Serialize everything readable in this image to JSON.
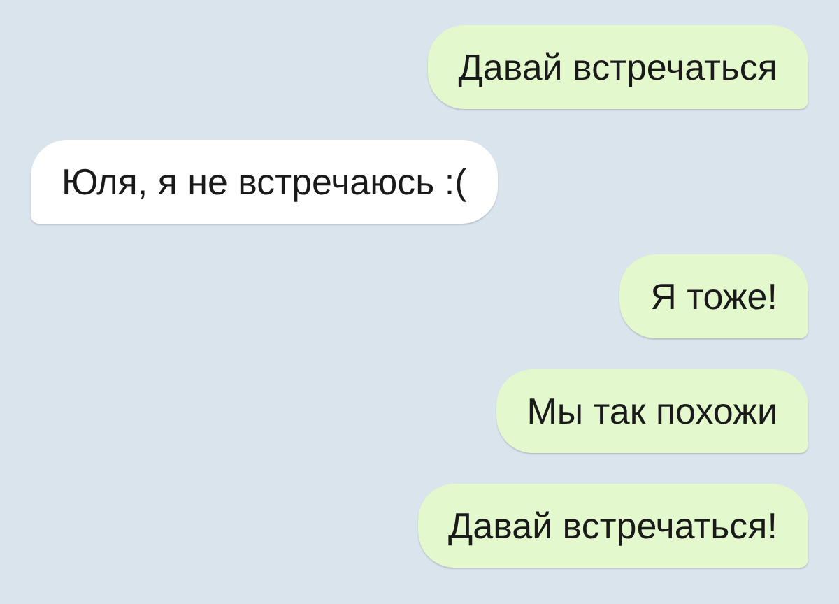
{
  "messages": [
    {
      "kind": "outgoing",
      "text": "Давай встречаться"
    },
    {
      "kind": "incoming",
      "text": "Юля, я не встречаюсь :("
    },
    {
      "kind": "outgoing",
      "text": "Я тоже!"
    },
    {
      "kind": "outgoing",
      "text": "Мы так похожи"
    },
    {
      "kind": "outgoing",
      "text": "Давай встречаться!"
    }
  ]
}
